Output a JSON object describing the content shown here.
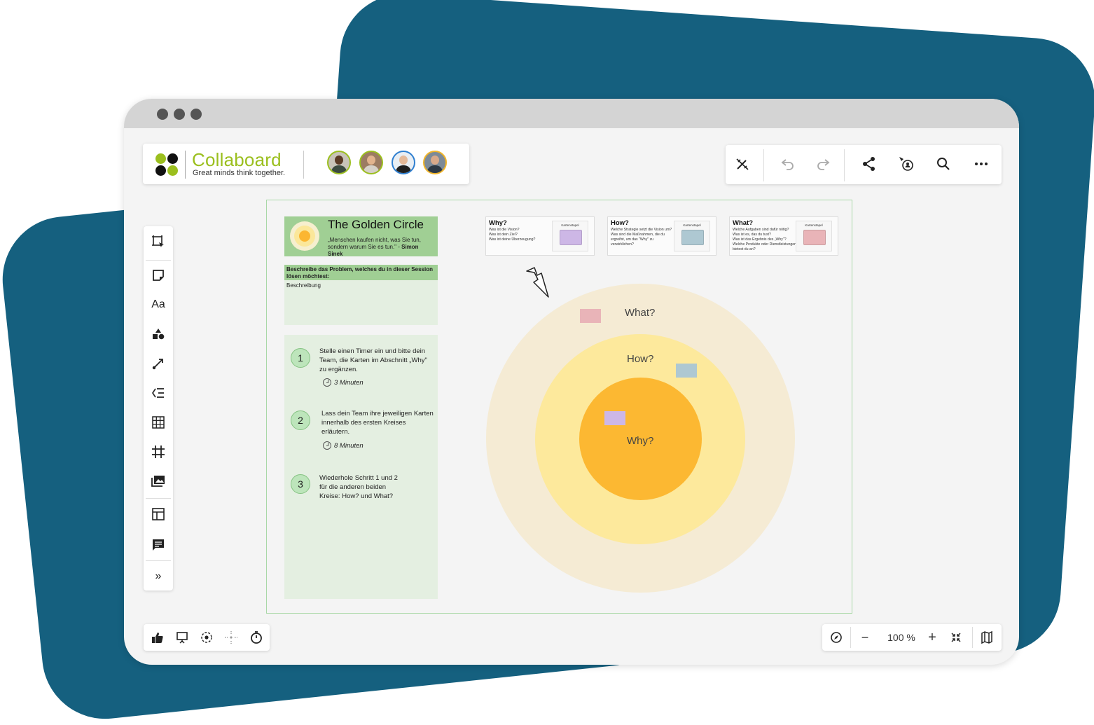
{
  "brand": {
    "name": "Collaboard",
    "tagline": "Great minds think together."
  },
  "users": [
    {
      "name": "user-1",
      "ring_color": "#9bbf1e"
    },
    {
      "name": "user-2",
      "ring_color": "#9bbf1e"
    },
    {
      "name": "user-3",
      "ring_color": "#2f7fd0"
    },
    {
      "name": "user-4",
      "ring_color": "#f0b429"
    }
  ],
  "toolbar": {
    "icons": [
      "magic-wand-icon",
      "undo-icon",
      "redo-icon",
      "share-icon",
      "follow-user-icon",
      "search-icon",
      "more-icon"
    ]
  },
  "sidebar": {
    "items": [
      {
        "name": "select-tool",
        "icon": "select-frame-icon"
      },
      {
        "name": "sticky-note-tool",
        "icon": "sticky-note-icon"
      },
      {
        "name": "text-tool",
        "label": "Aa"
      },
      {
        "name": "shapes-tool",
        "icon": "shapes-icon"
      },
      {
        "name": "connector-tool",
        "icon": "connector-icon"
      },
      {
        "name": "mindmap-tool",
        "icon": "mindmap-icon"
      },
      {
        "name": "table-tool",
        "icon": "table-icon"
      },
      {
        "name": "frame-tool",
        "icon": "frame-icon"
      },
      {
        "name": "media-tool",
        "icon": "image-icon"
      },
      {
        "name": "templates-tool",
        "icon": "template-icon"
      },
      {
        "name": "comment-tool",
        "icon": "comment-icon"
      },
      {
        "name": "expand-tool",
        "label": "»"
      }
    ]
  },
  "bottom_left": {
    "icons": [
      "thumbs-up-icon",
      "presentation-icon",
      "focus-icon",
      "attention-icon",
      "timer-icon"
    ]
  },
  "bottom_right": {
    "zoom": "100 %",
    "minus": "−",
    "plus": "+"
  },
  "board": {
    "header": {
      "title": "The Golden Circle",
      "quote": "„Menschen kaufen nicht, was Sie tun, sondern warum Sie es tun.\" - ",
      "author": "Simon Sinek"
    },
    "description": {
      "heading": "Beschreibe das Problem, welches du in dieser Session lösen möchtest:",
      "body": "Beschreibung"
    },
    "steps": [
      {
        "num": "1",
        "text": "Stelle einen Timer ein und bitte dein Team, die Karten im Abschnitt „Why\" zu ergänzen.",
        "time": "3 Minuten"
      },
      {
        "num": "2",
        "text": "Lass dein Team ihre jeweiligen Karten innerhalb des ersten Kreises erläutern.",
        "time": "8 Minuten"
      },
      {
        "num": "3",
        "text": "Wiederhole Schritt 1 und 2 für die anderen beiden Kreise: How? und What?"
      }
    ],
    "cards": [
      {
        "title": "Why?",
        "text": "Was ist die Vision?\nWas ist dein Ziel?\nWas ist deine Überzeugung?",
        "stack_label": "Kartenstapel",
        "color": "#cdb7e6"
      },
      {
        "title": "How?",
        "text": "Welche Strategie setzt die Vision um?\nWas sind die Maßnahmen, die du ergreifst, um das \"Why\" zu verwirklichen?",
        "stack_label": "Kartenstapel",
        "color": "#aec8d2"
      },
      {
        "title": "What?",
        "text": "Welche Aufgaben sind dafür nötig?\nWas ist es, das du tust?\nWas ist das Ergebnis des „Why\"?\nWelche Produkte oder Dienstleistungen bietest du an?",
        "stack_label": "Kartenstapel",
        "color": "#e9b4b8"
      }
    ],
    "circles": {
      "outer_label": "What?",
      "middle_label": "How?",
      "inner_label": "Why?",
      "outer_color": "#f5ebd4",
      "middle_color": "#fde99c",
      "inner_color": "#fcb832"
    },
    "sticky_colors": {
      "what": "#e9b4b8",
      "how": "#aec8d2",
      "why": "#cdb7e6"
    }
  },
  "colors": {
    "background_accent": "#15607f",
    "brand_green": "#9bbf1e",
    "card_green": "#a0cf94",
    "panel_green": "#e4efe1"
  }
}
